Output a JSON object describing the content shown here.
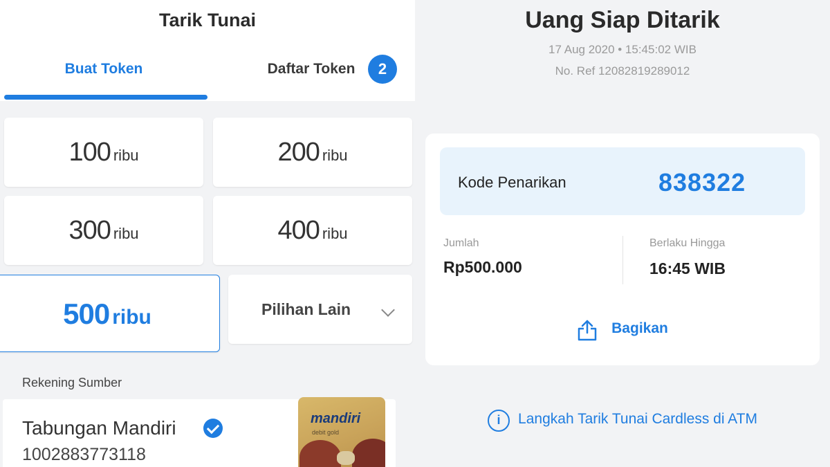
{
  "left": {
    "title": "Tarik Tunai",
    "tabs": [
      {
        "label": "Buat Token",
        "active": true
      },
      {
        "label": "Daftar Token",
        "badge": "2"
      }
    ],
    "amounts": [
      {
        "value": "100",
        "unit": "ribu"
      },
      {
        "value": "200",
        "unit": "ribu"
      },
      {
        "value": "300",
        "unit": "ribu"
      },
      {
        "value": "400",
        "unit": "ribu"
      },
      {
        "value": "500",
        "unit": "ribu",
        "selected": true
      }
    ],
    "other_option": "Pilihan Lain",
    "source_label": "Rekening Sumber",
    "account": {
      "name": "Tabungan Mandiri",
      "number": "1002883773118",
      "card_brand": "mandiri",
      "card_sub": "debit gold"
    }
  },
  "right": {
    "title": "Uang Siap Ditarik",
    "datetime": "17 Aug 2020 • 15:45:02 WIB",
    "ref": "No. Ref 12082819289012",
    "code_label": "Kode Penarikan",
    "code_value": "838322",
    "amount_label": "Jumlah",
    "amount_value": "Rp500.000",
    "valid_label": "Berlaku Hingga",
    "valid_value": "16:45 WIB",
    "share_label": "Bagikan",
    "info_link": "Langkah Tarik Tunai Cardless di ATM"
  },
  "colors": {
    "accent": "#1f7de0",
    "code_bg": "#e8f3fc",
    "panel_bg": "#f2f3f5"
  },
  "icons": [
    "check-badge-icon",
    "chevron-down-icon",
    "share-icon",
    "info-icon"
  ]
}
